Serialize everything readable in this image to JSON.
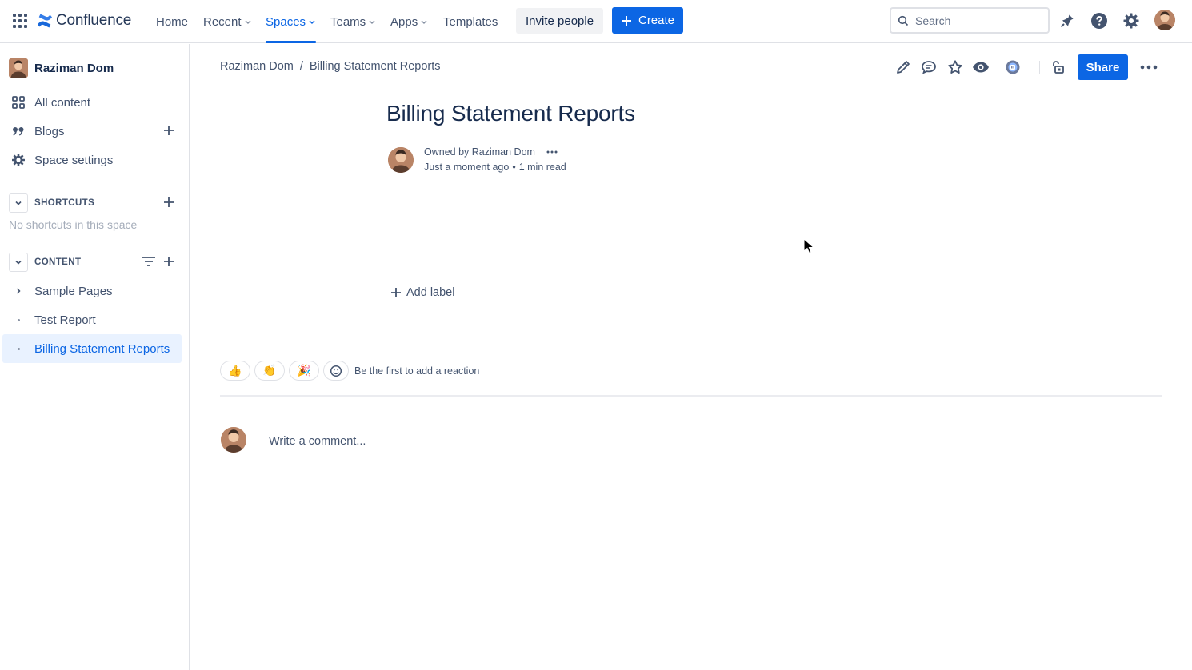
{
  "topnav": {
    "logo_text": "Confluence",
    "items": [
      {
        "label": "Home",
        "dropdown": false
      },
      {
        "label": "Recent",
        "dropdown": true
      },
      {
        "label": "Spaces",
        "dropdown": true,
        "active": true
      },
      {
        "label": "Teams",
        "dropdown": true
      },
      {
        "label": "Apps",
        "dropdown": true
      },
      {
        "label": "Templates",
        "dropdown": false
      }
    ],
    "invite_label": "Invite people",
    "create_label": "Create",
    "search_placeholder": "Search",
    "accent_color": "#0c66e4"
  },
  "sidebar": {
    "space_name": "Raziman Dom",
    "items": [
      {
        "label": "All content",
        "icon": "grid-icon"
      },
      {
        "label": "Blogs",
        "icon": "quote-icon"
      },
      {
        "label": "Space settings",
        "icon": "gear-icon"
      }
    ],
    "shortcuts": {
      "heading": "SHORTCUTS",
      "empty_text": "No shortcuts in this space"
    },
    "content": {
      "heading": "CONTENT",
      "tree": [
        {
          "label": "Sample Pages",
          "expandable": true
        },
        {
          "label": "Test Report",
          "expandable": false
        },
        {
          "label": "Billing Statement Reports",
          "expandable": false,
          "selected": true
        }
      ]
    }
  },
  "breadcrumb": {
    "space": "Raziman Dom",
    "separator": "/",
    "page": "Billing Statement Reports"
  },
  "toolbar": {
    "share_label": "Share"
  },
  "page": {
    "title": "Billing Statement Reports",
    "owner_text": "Owned by Raziman Dom",
    "updated": "Just a moment ago",
    "meta_separator": "•",
    "read_time": "1 min read",
    "add_label": "Add label"
  },
  "reactions": {
    "emojis": [
      "👍",
      "👏",
      "🎉"
    ],
    "prompt": "Be the first to add a reaction"
  },
  "comments": {
    "placeholder": "Write a comment..."
  }
}
